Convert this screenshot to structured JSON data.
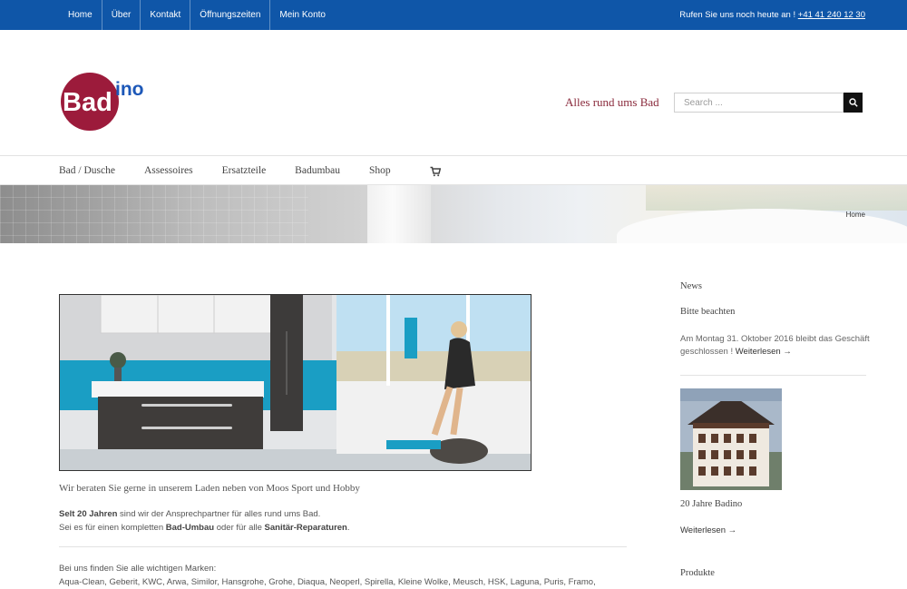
{
  "topbar": {
    "nav": [
      "Home",
      "Über",
      "Kontakt",
      "Öffnungszeiten",
      "Mein Konto"
    ],
    "phone_prefix": "Rufen Sie uns noch heute an !",
    "phone": "+41 41 240 12 30"
  },
  "header": {
    "logo_text": "Badino",
    "tagline": "Alles rund ums Bad",
    "search_placeholder": "Search ..."
  },
  "mainnav": {
    "items": [
      "Bad / Dusche",
      "Assessoires",
      "Ersatzteile",
      "Badumbau",
      "Shop"
    ]
  },
  "banner": {
    "breadcrumb": "Home"
  },
  "content": {
    "intro": "Wir beraten Sie gerne in unserem Laden neben von Moos Sport und Hobby",
    "p1_bold1": "Selt 20 Jahren",
    "p1_text1": " sind wir der Ansprechpartner für alles rund ums Bad.",
    "p1_text2": "Sei es für einen kompletten ",
    "p1_bold2": "Bad-Umbau",
    "p1_text3": " oder für alle ",
    "p1_bold3": "Sanitär-Reparaturen",
    "p1_text4": ".",
    "p2_line1": "Bei uns finden Sie alle wichtigen Marken:",
    "p2_line2": "Aqua-Clean, Geberit, KWC, Arwa, Similor, Hansgrohe, Grohe, Diaqua, Neoperl, Spirella, Kleine Wolke, Meusch, HSK, Laguna, Puris, Framo, Sidler,"
  },
  "sidebar": {
    "news_title": "News",
    "post_title": "Bitte beachten",
    "post_text": "Am Montag 31. Oktober 2016 bleibt das Geschäft geschlossen ! ",
    "post_link": "Weiterlesen →",
    "post2_title": "20 Jahre Badino",
    "post2_link": "Weiterlesen →",
    "products_title": "Produkte"
  },
  "colors": {
    "topbar": "#0f56a8",
    "logo_red": "#9c1b3b",
    "logo_blue": "#1d58b8",
    "tagline": "#8a2a3c"
  },
  "icons": {
    "search": "search-icon",
    "cart": "cart-icon"
  }
}
